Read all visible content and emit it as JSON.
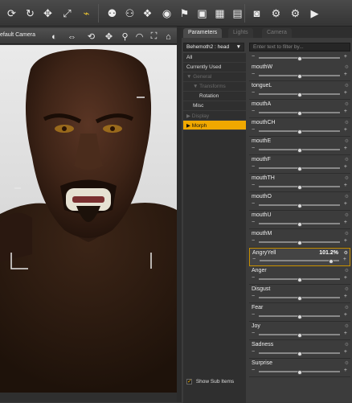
{
  "toolbar": {
    "icons": [
      "rotate-icon",
      "rotate-y-icon",
      "move-icon",
      "scale-icon",
      "warp-icon",
      "figure-icon",
      "figure-group-icon",
      "morph-icon",
      "render-icon",
      "pose-icon",
      "group-icon",
      "scene-icon",
      "save-icon",
      "camera-icon",
      "settings-icon",
      "render-settings-icon",
      "render-button-icon"
    ]
  },
  "viewport": {
    "camera_label": "efault Camera",
    "icons": [
      "sphere-icon",
      "dolly-icon",
      "rotate-cam-icon",
      "pan-icon",
      "zoom-icon",
      "orbit-icon",
      "frame-icon",
      "home-icon"
    ]
  },
  "panel": {
    "tabs": [
      "Parameters",
      "Lights",
      "Camera"
    ],
    "node_selector": "Behemoth2 : head",
    "filter_placeholder": "Enter text to filter by...",
    "tree": [
      {
        "label": "All",
        "state": "normal",
        "indent": 0
      },
      {
        "label": "Currently Used",
        "state": "normal",
        "indent": 0
      },
      {
        "label": "▼ General",
        "state": "dim",
        "indent": 0
      },
      {
        "label": "▼ Transforms",
        "state": "dim",
        "indent": 1
      },
      {
        "label": "Rotation",
        "state": "normal",
        "indent": 2
      },
      {
        "label": "Misc",
        "state": "normal",
        "indent": 1
      },
      {
        "label": "▶ Display",
        "state": "dim",
        "indent": 0
      },
      {
        "label": "▶ Morph",
        "state": "sel",
        "indent": 0
      }
    ],
    "show_sub_items": "Show Sub Items",
    "params": [
      {
        "name": "mouthW",
        "value": "",
        "level": 0.5
      },
      {
        "name": "tongueL",
        "value": "",
        "level": 0.5
      },
      {
        "name": "mouthA",
        "value": "",
        "level": 0.5
      },
      {
        "name": "mouthCH",
        "value": "",
        "level": 0.5
      },
      {
        "name": "mouthE",
        "value": "",
        "level": 0.5
      },
      {
        "name": "mouthF",
        "value": "",
        "level": 0.5
      },
      {
        "name": "mouthTH",
        "value": "",
        "level": 0.5
      },
      {
        "name": "mouthO",
        "value": "",
        "level": 0.5
      },
      {
        "name": "mouthU",
        "value": "",
        "level": 0.5
      },
      {
        "name": "mouthM",
        "value": "",
        "level": 0.5
      },
      {
        "name": "AngryYell",
        "value": "101.2%",
        "level": 0.9,
        "highlight": true
      },
      {
        "name": "Anger",
        "value": "",
        "level": 0.5
      },
      {
        "name": "Disgust",
        "value": "",
        "level": 0.5
      },
      {
        "name": "Fear",
        "value": "",
        "level": 0.5
      },
      {
        "name": "Joy",
        "value": "",
        "level": 0.5
      },
      {
        "name": "Sadness",
        "value": "",
        "level": 0.5
      },
      {
        "name": "Surprise",
        "value": "",
        "level": 0.5
      }
    ]
  }
}
